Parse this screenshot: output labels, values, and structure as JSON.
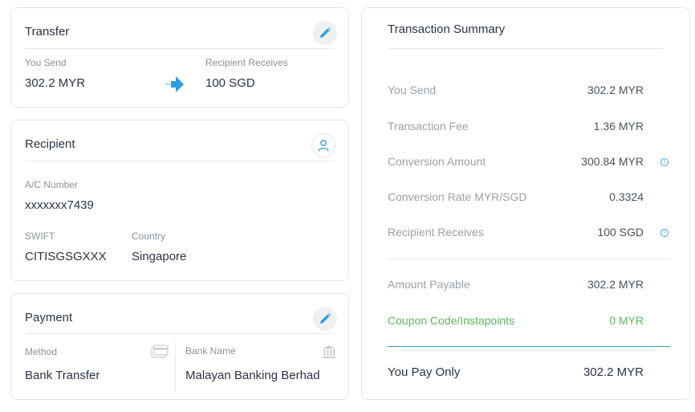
{
  "transfer": {
    "title": "Transfer",
    "you_send_label": "You Send",
    "you_send_value": "302.2 MYR",
    "recipient_receives_label": "Recipient Receives",
    "recipient_receives_value": "100 SGD"
  },
  "recipient": {
    "title": "Recipient",
    "ac_number_label": "A/C Number",
    "ac_number_value": "xxxxxxx7439",
    "swift_label": "SWIFT",
    "swift_value": "CITISGSGXXX",
    "country_label": "Country",
    "country_value": "Singapore"
  },
  "payment": {
    "title": "Payment",
    "method_label": "Method",
    "method_value": "Bank Transfer",
    "bank_name_label": "Bank Name",
    "bank_name_value": "Malayan Banking Berhad"
  },
  "summary": {
    "title": "Transaction Summary",
    "rows": [
      {
        "label": "You Send",
        "value": "302.2 MYR"
      },
      {
        "label": "Transaction Fee",
        "value": "1.36 MYR"
      },
      {
        "label": "Conversion Amount",
        "value": "300.84 MYR"
      },
      {
        "label": "Conversion Rate MYR/SGD",
        "value": "0.3324"
      },
      {
        "label": "Recipient Receives",
        "value": "100 SGD"
      }
    ],
    "amount_payable_label": "Amount Payable",
    "amount_payable_value": "302.2 MYR",
    "coupon_label": "Coupon Code/Instapoints",
    "coupon_value": "0 MYR",
    "you_pay_label": "You Pay Only",
    "you_pay_value": "302.2 MYR"
  },
  "colors": {
    "accent_blue": "#2f9be0",
    "coupon_green": "#5cb85c",
    "total_line": "#2aa8b5"
  },
  "icons": [
    "pencil-icon",
    "arrow-right-icon",
    "user-icon",
    "card-icon",
    "bank-icon",
    "info-icon"
  ]
}
